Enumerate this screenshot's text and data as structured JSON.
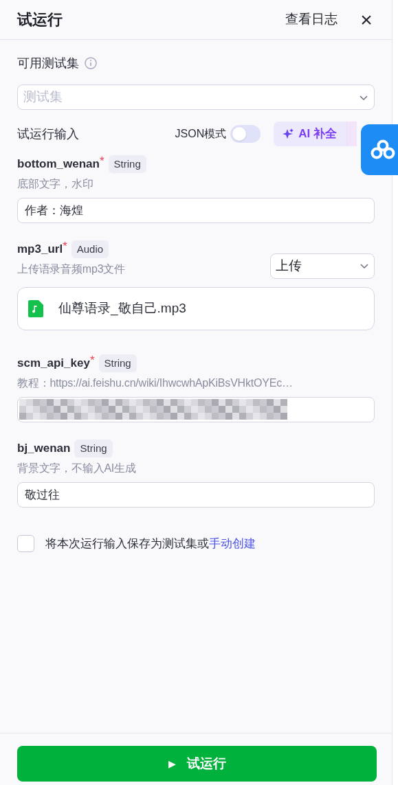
{
  "header": {
    "title": "试运行",
    "log_link": "查看日志",
    "close": "×"
  },
  "test_set": {
    "label": "可用测试集",
    "placeholder": "测试集"
  },
  "inputs_section": {
    "label": "试运行输入",
    "json_mode": {
      "label": "JSON模式",
      "on": false
    },
    "ai_button": "AI 补全"
  },
  "required_mark": "*",
  "fields": [
    {
      "kind": "text",
      "name": "bottom_wenan",
      "required": true,
      "type": "String",
      "description": "底部文字，水印",
      "value": "作者：海煌"
    },
    {
      "kind": "audio",
      "name": "mp3_url",
      "required": true,
      "type": "Audio",
      "description": "上传语录音频mp3文件",
      "mode": "上传",
      "file": "仙尊语录_敬自己.mp3"
    },
    {
      "kind": "redacted",
      "name": "scm_api_key",
      "required": true,
      "type": "String",
      "description": "教程：https://ai.feishu.cn/wiki/IhwcwhApKiBsVHktOYEc…"
    },
    {
      "kind": "text",
      "name": "bj_wenan",
      "required": false,
      "type": "String",
      "description": "背景文字，不输入AI生成",
      "value": "敬过往"
    }
  ],
  "save_option": {
    "checked": false,
    "label": "将本次运行输入保存为测试集或",
    "link": "手动创建"
  },
  "run_button": {
    "label": "试运行",
    "icon": "▶"
  }
}
